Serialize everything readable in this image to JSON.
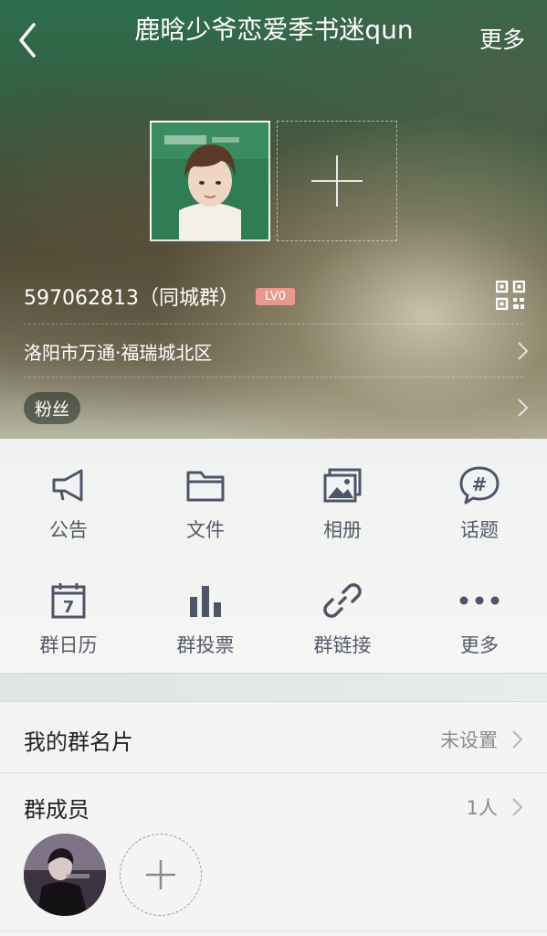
{
  "header": {
    "title": "鹿晗少爷恋爱季书迷qun",
    "more_label": "更多"
  },
  "group": {
    "id_text": "597062813（同城群）",
    "level": "LV0",
    "location": "洛阳市万通·福瑞城北区",
    "tag": "粉丝"
  },
  "menu": {
    "items": [
      {
        "label": "公告",
        "icon": "megaphone-icon"
      },
      {
        "label": "文件",
        "icon": "folder-icon"
      },
      {
        "label": "相册",
        "icon": "photo-album-icon"
      },
      {
        "label": "话题",
        "icon": "hashtag-bubble-icon"
      },
      {
        "label": "群日历",
        "icon": "calendar-icon"
      },
      {
        "label": "群投票",
        "icon": "bar-chart-icon"
      },
      {
        "label": "群链接",
        "icon": "link-icon"
      },
      {
        "label": "更多",
        "icon": "more-dots-icon"
      }
    ]
  },
  "card": {
    "label": "我的群名片",
    "value": "未设置"
  },
  "members": {
    "label": "群成员",
    "count": "1人"
  },
  "colors": {
    "menu_icon": "#4f5569",
    "level_badge": "#e7988f"
  }
}
